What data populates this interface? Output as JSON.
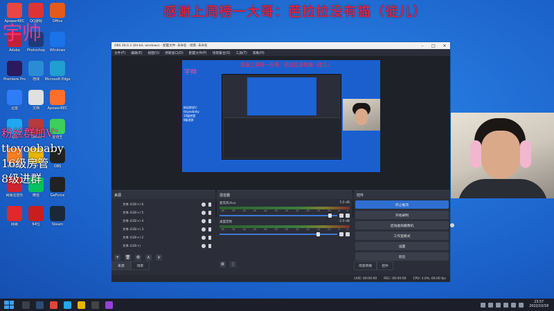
{
  "overlay": {
    "title": "感谢上周榜一大哥：芭拉拉没有猫（徒儿）",
    "nick": "宇帅",
    "fans_lines": [
      "粉丝群加V：",
      "ttoyoobaby",
      "16级房管",
      "8级进群"
    ]
  },
  "desktop_icons": [
    {
      "label": "ApowerREC",
      "icon": "recorder-icon",
      "color": "#e84545"
    },
    {
      "label": "QQ游戏",
      "icon": "game-icon",
      "color": "#d33"
    },
    {
      "label": "Office",
      "icon": "office-icon",
      "color": "#e55a1b"
    },
    {
      "label": "Adobe",
      "icon": "adobe-icon",
      "color": "#c21f3a"
    },
    {
      "label": "Photoshop",
      "icon": "photoshop-icon",
      "color": "#1f3a7a"
    },
    {
      "label": "Windows",
      "icon": "windows-icon",
      "color": "#1a73e8"
    },
    {
      "label": "Premiere Pro",
      "icon": "premiere-icon",
      "color": "#2a1a5e"
    },
    {
      "label": "地球",
      "icon": "globe-icon",
      "color": "#2b8cd6"
    },
    {
      "label": "Microsoft Edge",
      "icon": "edge-icon",
      "color": "#1fa0d0"
    },
    {
      "label": "迅雷",
      "icon": "thunder-icon",
      "color": "#2f7df6"
    },
    {
      "label": "文档",
      "icon": "doc-icon",
      "color": "#e0e0e0"
    },
    {
      "label": "ApowerREC",
      "icon": "recorder-icon",
      "color": "#ff6f2c"
    },
    {
      "label": "QQ",
      "icon": "qq-icon",
      "color": "#21a8f0"
    },
    {
      "label": "Office",
      "icon": "office-icon",
      "color": "#b83b3b"
    },
    {
      "label": "爱奇艺",
      "icon": "iqiyi-icon",
      "color": "#3ccf5b"
    },
    {
      "label": "腾讯视频",
      "icon": "tencent-video-icon",
      "color": "#ff7f1f"
    },
    {
      "label": "YY",
      "icon": "yy-icon",
      "color": "#e8b400"
    },
    {
      "label": "OBS",
      "icon": "obs-icon",
      "color": "#222"
    },
    {
      "label": "网易云音乐",
      "icon": "music-icon",
      "color": "#d2222d"
    },
    {
      "label": "微信",
      "icon": "wechat-icon",
      "color": "#07c160"
    },
    {
      "label": "GeForce",
      "icon": "geforce-icon",
      "color": "#222"
    },
    {
      "label": "网易",
      "icon": "netease-icon",
      "color": "#e0282d"
    },
    {
      "label": "64位",
      "icon": "cpu-icon",
      "color": "#c81e1e"
    },
    {
      "label": "Steam",
      "icon": "steam-icon",
      "color": "#1b2838"
    }
  ],
  "obs": {
    "window_title": "OBS 28.0.3 (64-bit, windows) - 配置文件: 未命名 - 场景: 未命名",
    "menu": [
      "文件(F)",
      "编辑(E)",
      "视图(V)",
      "停靠窗口(D)",
      "配置文件(P)",
      "场景集合(S)",
      "工具(T)",
      "帮助(H)"
    ],
    "preview": {
      "title": "感谢上周榜一大哥：芭拉拉没有猫（徒儿）",
      "nick": "宇帅",
      "fans": [
        "粉丝群加V：",
        "ttoyoobaby",
        "16级房管",
        "8级进群"
      ]
    },
    "prevbar": {
      "label": "未选择源",
      "btn1": "属性",
      "btn2": "滤镜"
    },
    "sources": {
      "header": "来源",
      "items": [
        "文本 (GDI+) 6",
        "文本 (GDI+) 5",
        "文本 (GDI+) 4",
        "文本 (GDI+) 3",
        "文本 (GDI+) 2",
        "文本 (GDI+)"
      ],
      "tabs": [
        "来源",
        "场景"
      ]
    },
    "mixer": {
      "header": "混音器",
      "channels": [
        {
          "name": "麦克风/Aux",
          "db": "5.0 dB",
          "level": 0.95
        },
        {
          "name": "桌面音频",
          "db": "-2.0 dB",
          "level": 0.85
        }
      ],
      "ticks": [
        "-60",
        "-55",
        "-50",
        "-45",
        "-40",
        "-35",
        "-30",
        "-25",
        "-20",
        "-15",
        "-10",
        "-5",
        "0"
      ]
    },
    "controls": {
      "header": "控件",
      "buttons": [
        "停止推流",
        "开始录制",
        "启动虚拟摄像机",
        "工作室模式",
        "设置",
        "退出"
      ],
      "tabs": [
        "场景转换",
        "控件"
      ]
    },
    "status": {
      "live": "LIVE: 00:00:00",
      "rec": "REC: 00:00:00",
      "cpu": "CPU: 3.0%, 60.00 fps"
    }
  },
  "taskbar": {
    "apps": [
      {
        "icon": "search-icon",
        "color": "#3a3f4d"
      },
      {
        "icon": "steam-icon",
        "color": "#2a4d77"
      },
      {
        "icon": "chrome-icon",
        "color": "#e84335"
      },
      {
        "icon": "qq-icon",
        "color": "#21a8f0"
      },
      {
        "icon": "file-explorer-icon",
        "color": "#e8b400"
      },
      {
        "icon": "obs-icon",
        "color": "#444"
      },
      {
        "icon": "game-icon",
        "color": "#9a3fd6"
      }
    ],
    "time": "23:57",
    "date": "2022/10/18"
  }
}
